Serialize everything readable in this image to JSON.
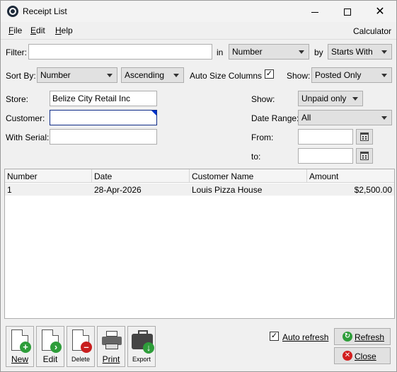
{
  "window": {
    "title": "Receipt List"
  },
  "menu": {
    "file": "File",
    "edit": "Edit",
    "help": "Help",
    "calculator": "Calculator"
  },
  "filter": {
    "label": "Filter:",
    "value": "",
    "in_label": "in",
    "in_value": "Number",
    "by_label": "by",
    "by_value": "Starts With"
  },
  "sort": {
    "label": "Sort By:",
    "field": "Number",
    "order": "Ascending",
    "auto_size_label": "Auto Size Columns",
    "auto_size_checked": true,
    "show_label": "Show:",
    "show_value": "Posted Only"
  },
  "criteria": {
    "store_label": "Store:",
    "store_value": "Belize City Retail Inc",
    "customer_label": "Customer:",
    "customer_value": "",
    "serial_label": "With Serial:",
    "serial_value": "",
    "show_label": "Show:",
    "show_value": "Unpaid only",
    "date_range_label": "Date Range:",
    "date_range_value": "All",
    "from_label": "From:",
    "from_value": "",
    "to_label": "to:",
    "to_value": ""
  },
  "grid": {
    "columns": [
      "Number",
      "Date",
      "Customer Name",
      "Amount"
    ],
    "rows": [
      {
        "number": "1",
        "date": "28-Apr-2026",
        "customer": "Louis Pizza House",
        "amount": "$2,500.00"
      }
    ]
  },
  "toolbar": {
    "new": "New",
    "edit": "Edit",
    "delete": "Delete",
    "print": "Print",
    "export": "Export"
  },
  "actions": {
    "auto_refresh_label": "Auto refresh",
    "auto_refresh_checked": true,
    "refresh": "Refresh",
    "close": "Close"
  }
}
